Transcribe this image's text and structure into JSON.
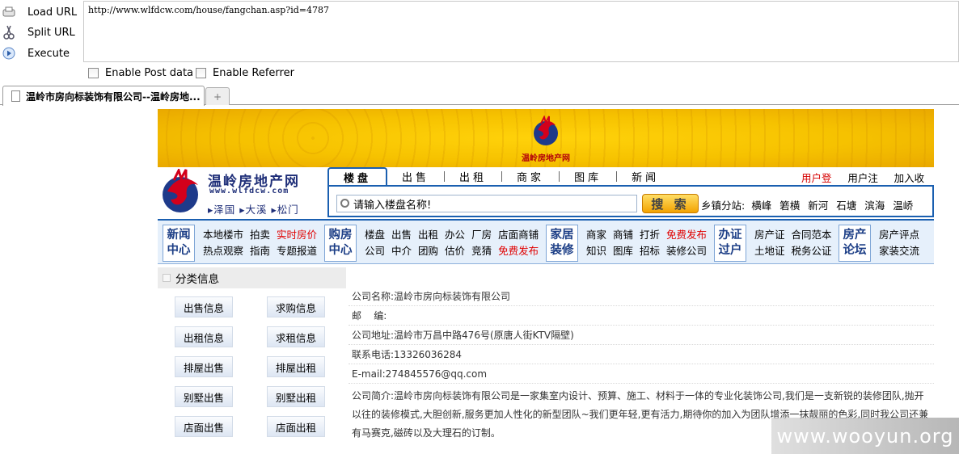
{
  "hackbar": {
    "load_url": "Load URL",
    "split_url": "Split URL",
    "execute": "Execute",
    "url_value": "http://www.wlfdcw.com/house/fangchan.asp?id=4787",
    "enable_post": "Enable Post data",
    "enable_referrer": "Enable Referrer"
  },
  "tabs": {
    "active_title": "温岭市房向标装饰有限公司--温岭房地...",
    "new_tab_symbol": "+"
  },
  "banner": {
    "logo_text": "温岭房地产网"
  },
  "site": {
    "name_cn": "温岭房地产网",
    "name_en": "www.wlfdcw.com",
    "locations": "▸泽国 ▸大溪 ▸松门"
  },
  "search": {
    "tabs": [
      "楼盘",
      "出售",
      "出租",
      "商家",
      "图库",
      "新闻"
    ],
    "placeholder": "请输入楼盘名称!",
    "button": "搜 索",
    "township_label": "乡镇分站:",
    "townships": [
      "横峰",
      "箬横",
      "新河",
      "石塘",
      "滨海",
      "温峤"
    ],
    "user_links": [
      "用户登录",
      "用户注册",
      "加入收藏"
    ]
  },
  "nav": {
    "blocks": [
      "新闻\n中心",
      "购房\n中心",
      "家居\n装修",
      "办证\n过户",
      "房产\n论坛"
    ],
    "group1": {
      "row1": [
        "本地楼市",
        "拍卖",
        "实时房价"
      ],
      "row2": [
        "热点观察",
        "指南",
        "专题报道"
      ]
    },
    "group2": {
      "row1": [
        "楼盘",
        "出售",
        "出租",
        "办公",
        "厂房",
        "店面商铺"
      ],
      "row2": [
        "公司",
        "中介",
        "团购",
        "估价",
        "竞猜",
        "免费发布"
      ]
    },
    "group3": {
      "row1": [
        "商家",
        "商铺",
        "打折",
        "免费发布"
      ],
      "row2": [
        "知识",
        "图库",
        "招标",
        "装修公司"
      ]
    },
    "group4": {
      "row1": [
        "房产证",
        "合同范本"
      ],
      "row2": [
        "土地证",
        "税务公证"
      ]
    },
    "group5": {
      "row1": [
        "房产评点"
      ],
      "row2": [
        "家装交流"
      ]
    }
  },
  "sidebar": {
    "title": "分类信息",
    "items": [
      "出售信息",
      "求购信息",
      "出租信息",
      "求租信息",
      "排屋出售",
      "排屋出租",
      "别墅出售",
      "别墅出租",
      "店面出售",
      "店面出租"
    ]
  },
  "details": {
    "company": "公司名称:温岭市房向标装饰有限公司",
    "postcode": "邮    编:",
    "address": "公司地址:温岭市万昌中路476号(原唐人街KTV隔壁)",
    "phone": "联系电话:13326036284",
    "email": "E-mail:274845576@qq.com",
    "intro": "公司简介:温岭市房向标装饰有限公司是一家集室内设计、预算、施工、材料于一体的专业化装饰公司,我们是一支新锐的装修团队,抛开以往的装修模式,大胆创新,服务更加人性化的新型团队~我们更年轻,更有活力,期待你的加入为团队增添一抹靓丽的色彩,同时我公司还兼有马赛克,磁砖以及大理石的订制。"
  },
  "watermark": "www.wooyun.org",
  "colors": {
    "brand_blue": "#1a5fb0",
    "banner_yellow": "#f6c200",
    "link_red": "#e00000"
  }
}
